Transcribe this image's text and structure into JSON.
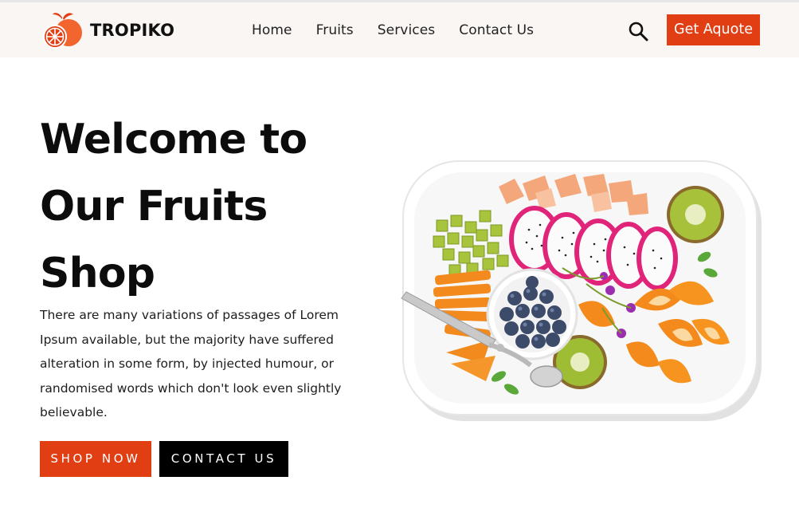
{
  "header": {
    "brand": "TROPIKO",
    "nav": [
      {
        "label": "Home"
      },
      {
        "label": "Fruits"
      },
      {
        "label": "Services"
      },
      {
        "label": "Contact Us"
      }
    ],
    "quote_button": "Get Aquote",
    "search_icon": "search-icon"
  },
  "hero": {
    "title_line1": "Welcome to",
    "title_line2": "Our Fruits",
    "title_line3": "Shop",
    "description": "There are many variations of passages of Lorem Ipsum available, but the majority have suffered alteration in some form, by injected humour, or randomised words which don't look even slightly believable.",
    "shop_button": "SHOP NOW",
    "contact_button": "CONTACT US",
    "image": "fruit-platter-image"
  },
  "colors": {
    "accent": "#e13e14",
    "header_bg": "#faf6f3",
    "dark_button": "#000000"
  }
}
